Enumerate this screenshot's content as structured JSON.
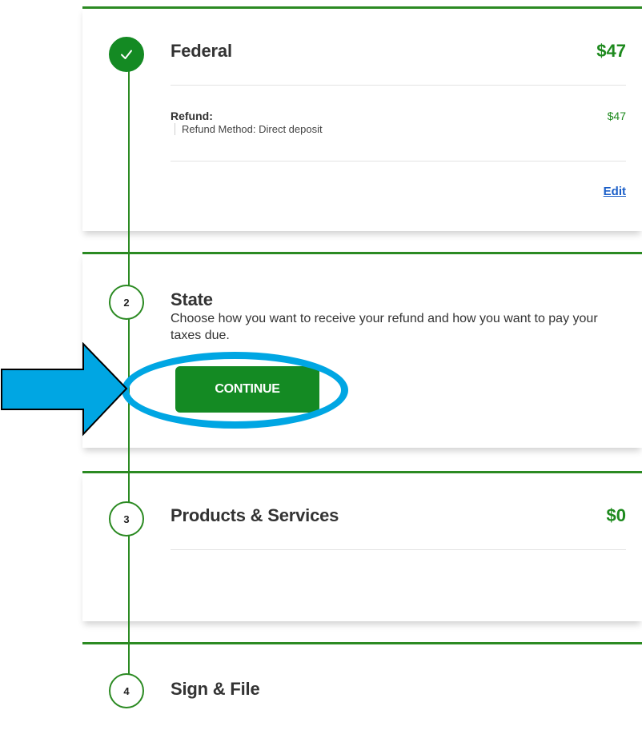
{
  "colors": {
    "accent_green": "#148a23",
    "link_blue": "#1a5ec8",
    "annotation_blue": "#00a6e3"
  },
  "steps": [
    {
      "number": "",
      "icon": "checkmark-icon",
      "title": "Federal",
      "amount": "$47",
      "refund_label": "Refund:",
      "refund_amount": "$47",
      "refund_method": "Refund Method: Direct deposit",
      "edit_label": "Edit"
    },
    {
      "number": "2",
      "title": "State",
      "description": "Choose how you want to receive your refund and how you want to pay your taxes due.",
      "button_label": "CONTINUE"
    },
    {
      "number": "3",
      "title": "Products & Services",
      "amount": "$0"
    },
    {
      "number": "4",
      "title": "Sign & File"
    }
  ],
  "annotation": {
    "icon": "right-arrow-icon",
    "highlight": "ellipse-highlight"
  }
}
